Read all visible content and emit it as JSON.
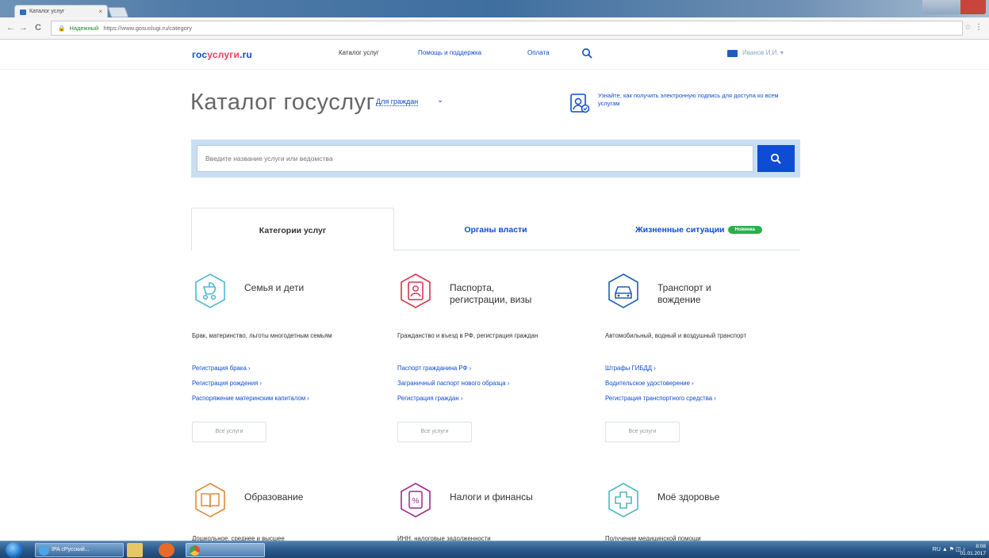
{
  "browser": {
    "tab_title": "Каталог услуг",
    "tab_close": "×",
    "back": "←",
    "forward": "→",
    "reload": "C",
    "secure_label": "Надежный",
    "url": "https://www.gosuslugi.ru/category",
    "star": "☆",
    "menu": "⋮"
  },
  "header": {
    "logo_gos": "гос",
    "logo_uslugi": "услуги",
    "logo_ru": ".ru",
    "nav_catalog": "Каталог услуг",
    "nav_help": "Помощь и поддержка",
    "nav_pay": "Оплата",
    "user_name": "Иванов И.И. ▾"
  },
  "page": {
    "title": "Каталог госуслуг",
    "audience": "Для граждан",
    "audience_chevron": "⌄",
    "esign_text": "Узнайте, как получить электронную подпись для доступа ко всем услугам",
    "search_placeholder": "Введите название услуги или ведомства"
  },
  "tabs": {
    "categories": "Категории услуг",
    "authorities": "Органы власти",
    "life_situations": "Жизненные ситуации",
    "new_badge": "Новинка"
  },
  "categories": [
    {
      "title_line1": "Семья и дети",
      "title_line2": "",
      "desc": "Брак, материнство, льготы многодетным семьям",
      "links": [
        "Регистрация брака ›",
        "Регистрация рождения ›",
        "Распоряжение материнским капиталом ›"
      ],
      "all": "Все услуги",
      "color": "#4db8d6"
    },
    {
      "title_line1": "Паспорта,",
      "title_line2": "регистрации, визы",
      "desc": "Гражданство и въезд в РФ, регистрация граждан",
      "links": [
        "Паспорт гражданина РФ ›",
        "Заграничный паспорт нового образца ›",
        "Регистрация граждан ›"
      ],
      "all": "Все услуги",
      "color": "#d6334e"
    },
    {
      "title_line1": "Транспорт и",
      "title_line2": "вождение",
      "desc": "Автомобильный, водный и воздушный транспорт",
      "links": [
        "Штрафы ГИБДД ›",
        "Водительское удостоверение ›",
        "Регистрация транспортного средства ›"
      ],
      "all": "Все услуги",
      "color": "#1d5fb7"
    },
    {
      "title_line1": "Образование",
      "title_line2": "",
      "desc": "Дошкольное, среднее и высшее",
      "color": "#e08a3c"
    },
    {
      "title_line1": "Налоги и финансы",
      "title_line2": "",
      "desc": "ИНН, налоговые задолженности",
      "color": "#9b2b8a"
    },
    {
      "title_line1": "Моё здоровье",
      "title_line2": "",
      "desc": "Получение медицинской помощи",
      "color": "#4db8c4"
    }
  ],
  "taskbar": {
    "ie_label": "IPA сРусский...",
    "tray_text": "RU ▲ ⚑ ◫ ♪",
    "clock_time": "8:08",
    "clock_date": "01.01.2017"
  }
}
